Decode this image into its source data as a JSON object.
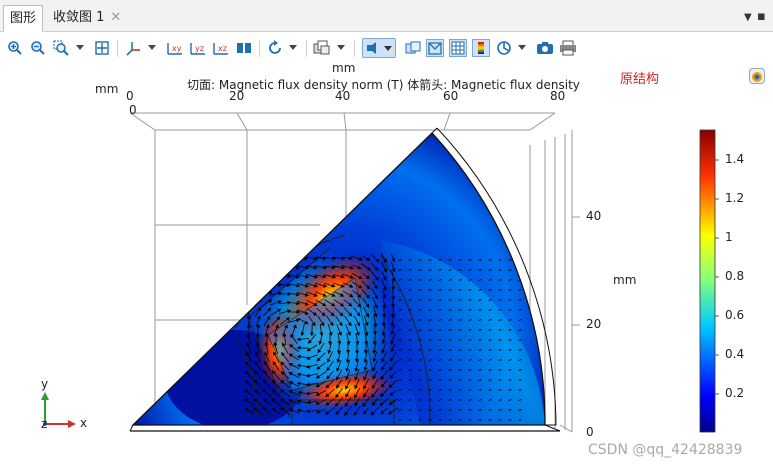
{
  "tabs": [
    {
      "label": "图形"
    },
    {
      "label": "收敛图 1"
    }
  ],
  "tab_close_symbol": "✕",
  "toolbar_icons": [
    "zoom-in-icon",
    "zoom-out-icon",
    "zoom-box-icon",
    "zoom-extents-icon",
    "axis-orientation-icon",
    "xy-plane-icon",
    "yz-plane-icon",
    "xz-plane-icon",
    "view-icon",
    "rotate-icon",
    "scene-icon",
    "select-icon",
    "transparency-icon",
    "wireframe-icon",
    "grid-icon",
    "colorbar-icon",
    "render-icon",
    "camera-icon",
    "print-icon"
  ],
  "plot": {
    "title": "切面: Magnetic flux density norm (T)  体箭头: Magnetic flux density",
    "annotation": "原结构",
    "top_axis": {
      "unit_label": "mm",
      "ticks": [
        "0",
        "20",
        "40",
        "60",
        "80"
      ],
      "left_label": "mm",
      "left_tick": "0"
    },
    "right_axis": {
      "unit_label": "mm",
      "ticks": [
        "40",
        "20",
        "0"
      ]
    },
    "colorbar": {
      "ticks": [
        "1.4",
        "1.2",
        "1",
        "0.8",
        "0.6",
        "0.4",
        "0.2"
      ],
      "range": [
        0,
        1.55
      ]
    },
    "triad": {
      "y": "y",
      "x": "x",
      "z": "z"
    },
    "watermark": "CSDN @qq_42428839"
  },
  "colors": {
    "field_low": "#0008a8",
    "field_mid": "#00c8d0",
    "field_high": "#d01000",
    "arrow": "#000000"
  }
}
